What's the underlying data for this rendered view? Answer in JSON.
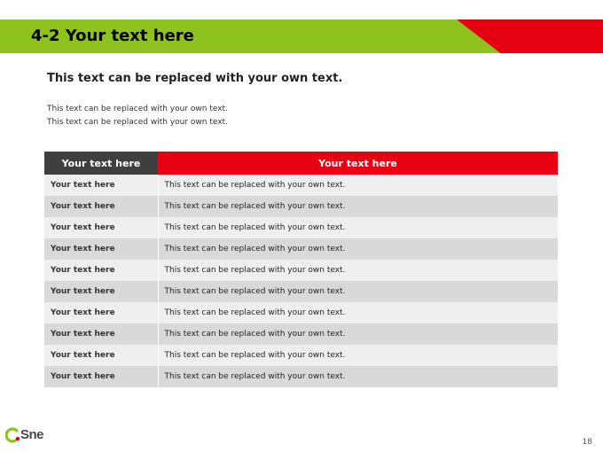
{
  "slide": {
    "title": "4-2 Your text here",
    "subheading": "This text can be replaced with your own text.",
    "body_lines": [
      "This text can be replaced with your own text.",
      "This text can be replaced with your own text."
    ],
    "page_number": "18"
  },
  "table": {
    "headers": [
      "Your text here",
      "Your text here"
    ],
    "rows": [
      [
        "Your text here",
        "This text can be replaced with your own text."
      ],
      [
        "Your text here",
        "This text can be replaced with your own text."
      ],
      [
        "Your text here",
        "This text can be replaced with your own text."
      ],
      [
        "Your text here",
        "This text can be replaced with your own text."
      ],
      [
        "Your text here",
        "This text can be replaced with your own text."
      ],
      [
        "Your text here",
        "This text can be replaced with your own text."
      ],
      [
        "Your text here",
        "This text can be replaced with your own text."
      ],
      [
        "Your text here",
        "This text can be replaced with your own text."
      ],
      [
        "Your text here",
        "This text can be replaced with your own text."
      ],
      [
        "Your text here",
        "This text can be replaced with your own text."
      ]
    ]
  },
  "logo": {
    "text": "Sne",
    "icon": "c-leaf-icon"
  },
  "colors": {
    "green": "#8dc21f",
    "red": "#e50012",
    "dark_header": "#3f3f3f",
    "row_light": "#efefef",
    "row_dark": "#d9d9d9"
  }
}
